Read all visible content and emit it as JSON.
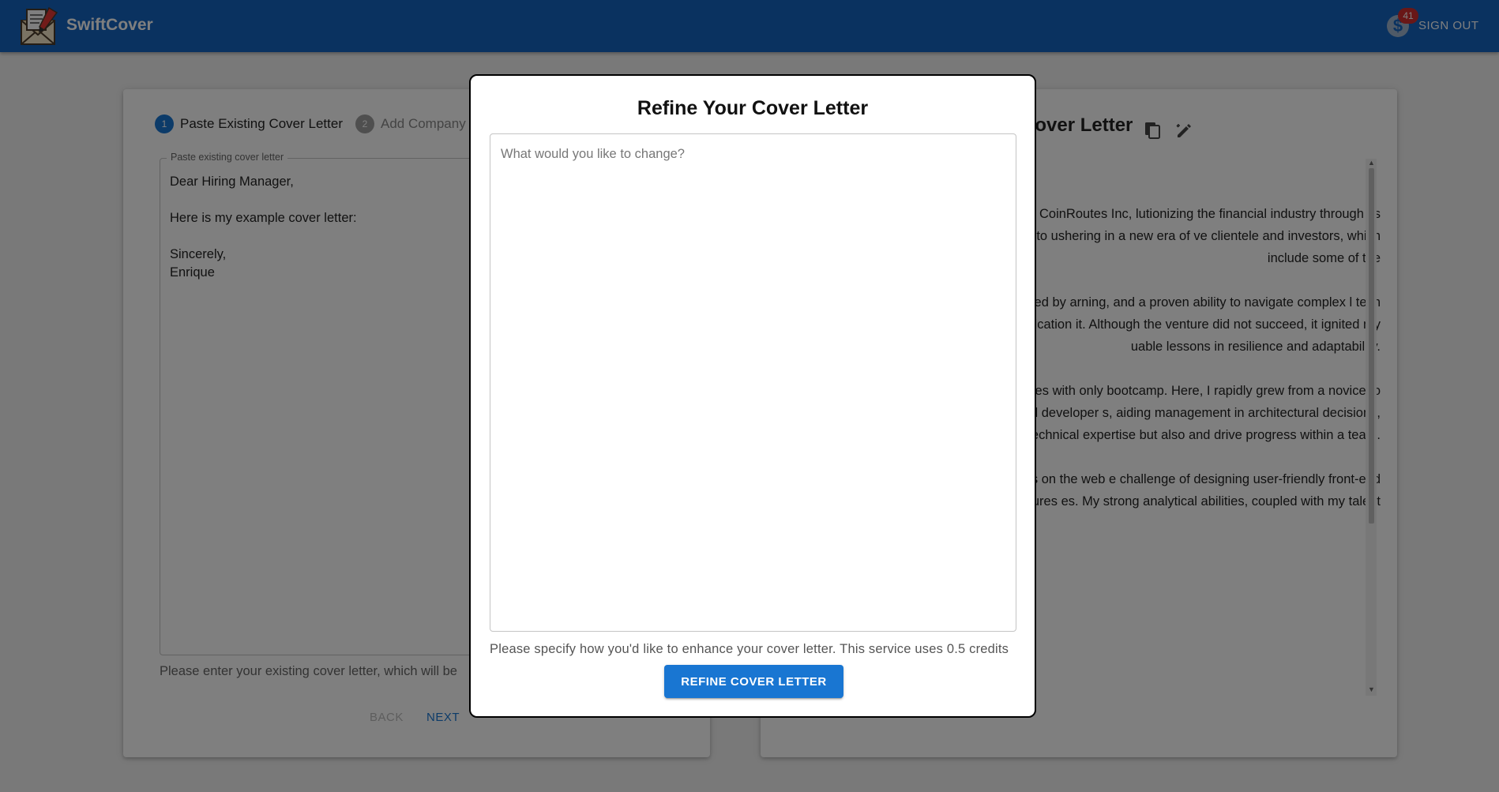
{
  "header": {
    "brand": "SwiftCover",
    "credits_badge": "41",
    "sign_out_label": "SIGN OUT",
    "colors": {
      "appbar": "#1565c0",
      "badge": "#d32f2f"
    }
  },
  "stepper": {
    "steps": [
      {
        "number": "1",
        "label": "Paste Existing Cover Letter",
        "state": "active"
      },
      {
        "number": "2",
        "label": "Add Company D",
        "state": "inactive"
      }
    ]
  },
  "paste_field": {
    "legend": "Paste existing cover letter",
    "value": "Dear Hiring Manager,\n\nHere is my example cover letter:\n\nSincerely,\nEnrique",
    "helper": "Please enter your existing cover letter, which will be"
  },
  "nav": {
    "back_label": "BACK",
    "next_label": "NEXT"
  },
  "generated": {
    "title_visible": "Cover Letter",
    "paragraphs": [
      "st in the Frontend Engineer position at CoinRoutes Inc, lutionizing the financial industry through its innovative nspired by your commitment to ushering in a new era of ve clientele and investors, which include some of the",
      "was far from conventional, but it was fueled by arning, and a proven ability to navigate complex l tech company, I found myself building an application it. Although the venture did not succeed, it ignited my uable lessons in resilience and adaptability.",
      "e engineering, taking a position at CoinRoutes with only bootcamp. Here, I rapidly grew from a novice to a e development team. I took on mid-level developer s, aiding management in architectural decisions, and ence not only honed my technical expertise but also and drive progress within a team.",
      "o the role's focus on leading team efforts on the web e challenge of designing user-friendly front-end features es. My strong analytical abilities, coupled with my talent"
    ]
  },
  "modal": {
    "title": "Refine Your Cover Letter",
    "textarea_placeholder": "What would you like to change?",
    "helper": "Please specify how you'd like to enhance your cover letter. This service uses 0.5 credits",
    "button_label": "REFINE COVER LETTER",
    "colors": {
      "primary": "#1976d2"
    }
  }
}
